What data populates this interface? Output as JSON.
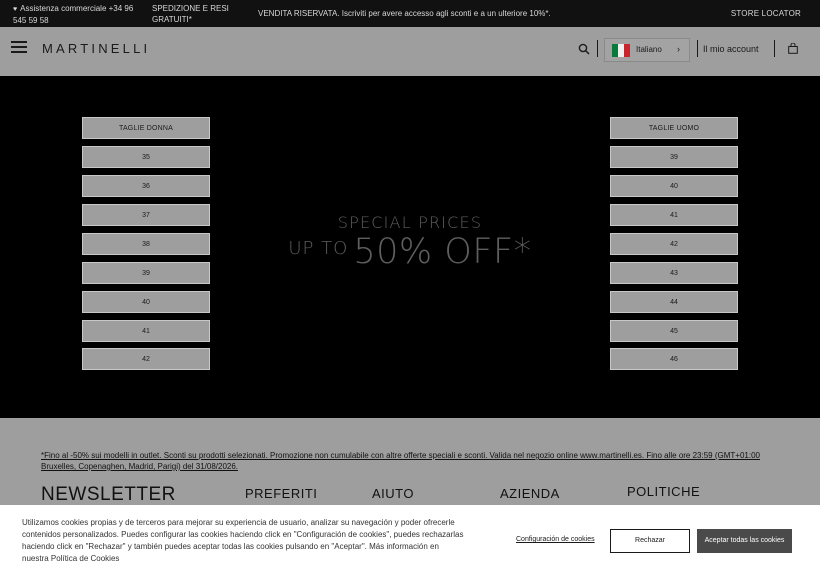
{
  "topbar": {
    "assistance": "Assistenza commerciale +34 96 545 59 58",
    "shipping": "SPEDIZIONE E RESI GRATUITI*",
    "promo": "VENDITA RISERVATA. Iscriviti per avere accesso agli sconti e a un ulteriore 10%*.",
    "store_locator": "STORE LOCATOR"
  },
  "header": {
    "logo": "MARTINELLI",
    "language": "Italiano",
    "account": "Il mio account",
    "icons": {
      "menu": "hamburger-icon",
      "search": "search-icon",
      "bag": "shopping-bag-icon",
      "flag": "italy-flag-icon",
      "chevron": "chevron-right-icon"
    }
  },
  "hero": {
    "women_title": "TAGLIE DONNA",
    "women_sizes": [
      "35",
      "36",
      "37",
      "38",
      "39",
      "40",
      "41",
      "42"
    ],
    "men_title": "TAGLIE UOMO",
    "men_sizes": [
      "39",
      "40",
      "41",
      "42",
      "43",
      "44",
      "45",
      "46"
    ],
    "special_prices": "SPECIAL PRICES",
    "up_to": "UP TO",
    "discount": "50% OFF*"
  },
  "footer": {
    "footnote": "*Fino al -50% sui modelli in outlet. Sconti su prodotti selezionati. Promozione non cumulabile con altre offerte speciali e sconti. Valida nel negozio online www.martinelli.es. Fino alle ore 23:59 (GMT+01:00 Bruxelles, Copenaghen, Madrid, Parigi) del 31/08/2026.",
    "newsletter": "NEWSLETTER",
    "columns": [
      "PREFERITI",
      "AIUTO",
      "AZIENDA",
      "POLITICHE"
    ]
  },
  "cookies": {
    "text": "Utilizamos cookies propias y de terceros para mejorar su experiencia de usuario, analizar su navegación y poder ofrecerle contenidos personalizados. Puedes configurar las cookies haciendo click en \"Configuración de cookies\", puedes rechazarlas haciendo click en \"Rechazar\" y también puedes aceptar todas las cookies pulsando en \"Aceptar\". Más información en nuestra Política de Cookies",
    "config": "Configuración de cookies",
    "reject": "Rechazar",
    "accept": "Aceptar todas las cookies"
  },
  "colors": {
    "topbar": "#111111",
    "overlay": "#9e9e9e",
    "hero": "#000000",
    "accept_button": "#4a4a4a"
  }
}
